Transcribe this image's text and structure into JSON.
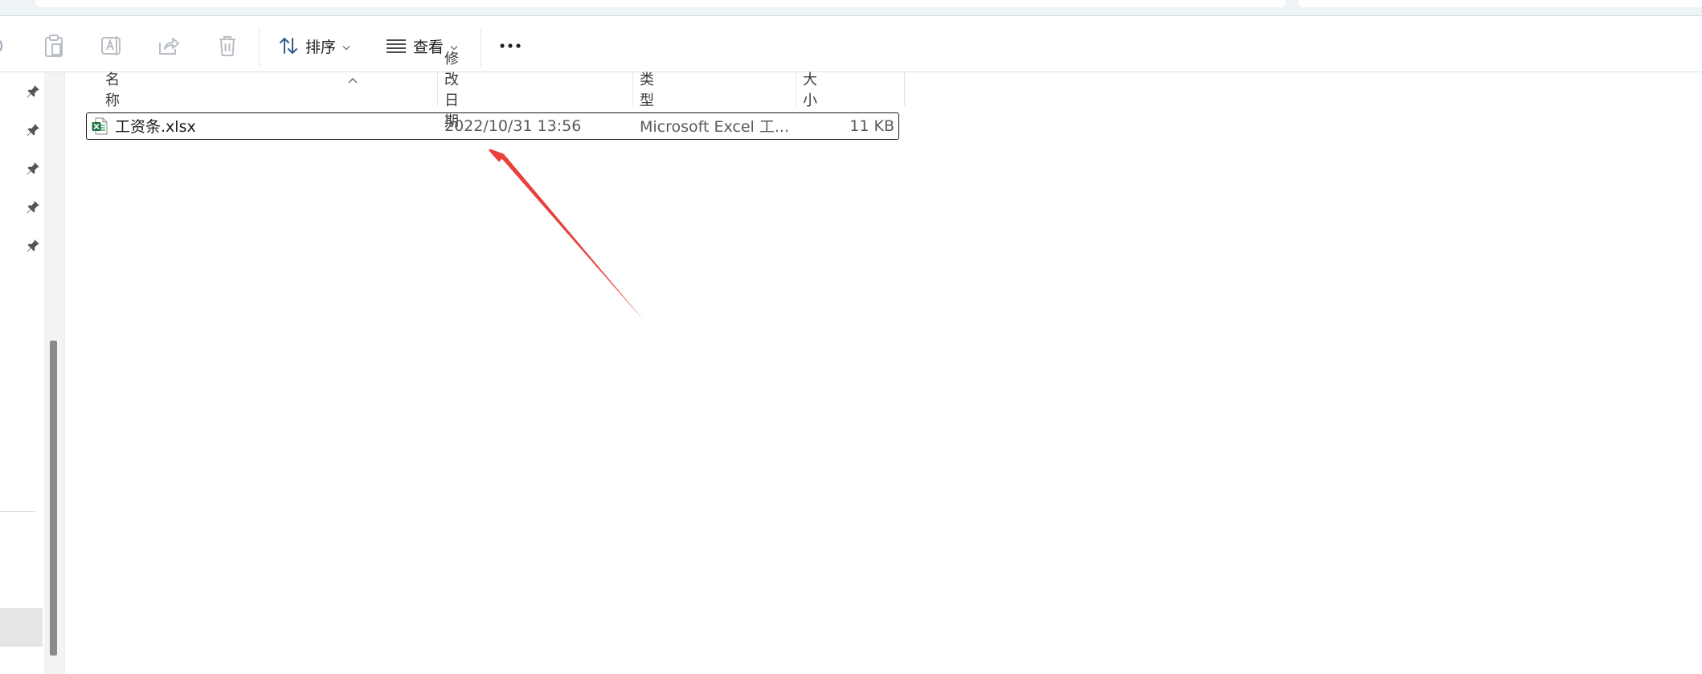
{
  "toolbar": {
    "sort_label": "排序",
    "view_label": "查看",
    "more_label": "…"
  },
  "file_list": {
    "columns": {
      "name": "名称",
      "modified": "修改日期",
      "type": "类型",
      "size": "大小"
    },
    "rows": [
      {
        "name": "工资条.xlsx",
        "modified": "2022/10/31 13:56",
        "type": "Microsoft Excel 工...",
        "size": "11 KB",
        "icon": "excel-file-icon",
        "selected": true
      }
    ]
  },
  "colors": {
    "excel_green": "#1e7145",
    "annotation_arrow": "#e8413c",
    "selection_border": "#1a1a1a"
  }
}
